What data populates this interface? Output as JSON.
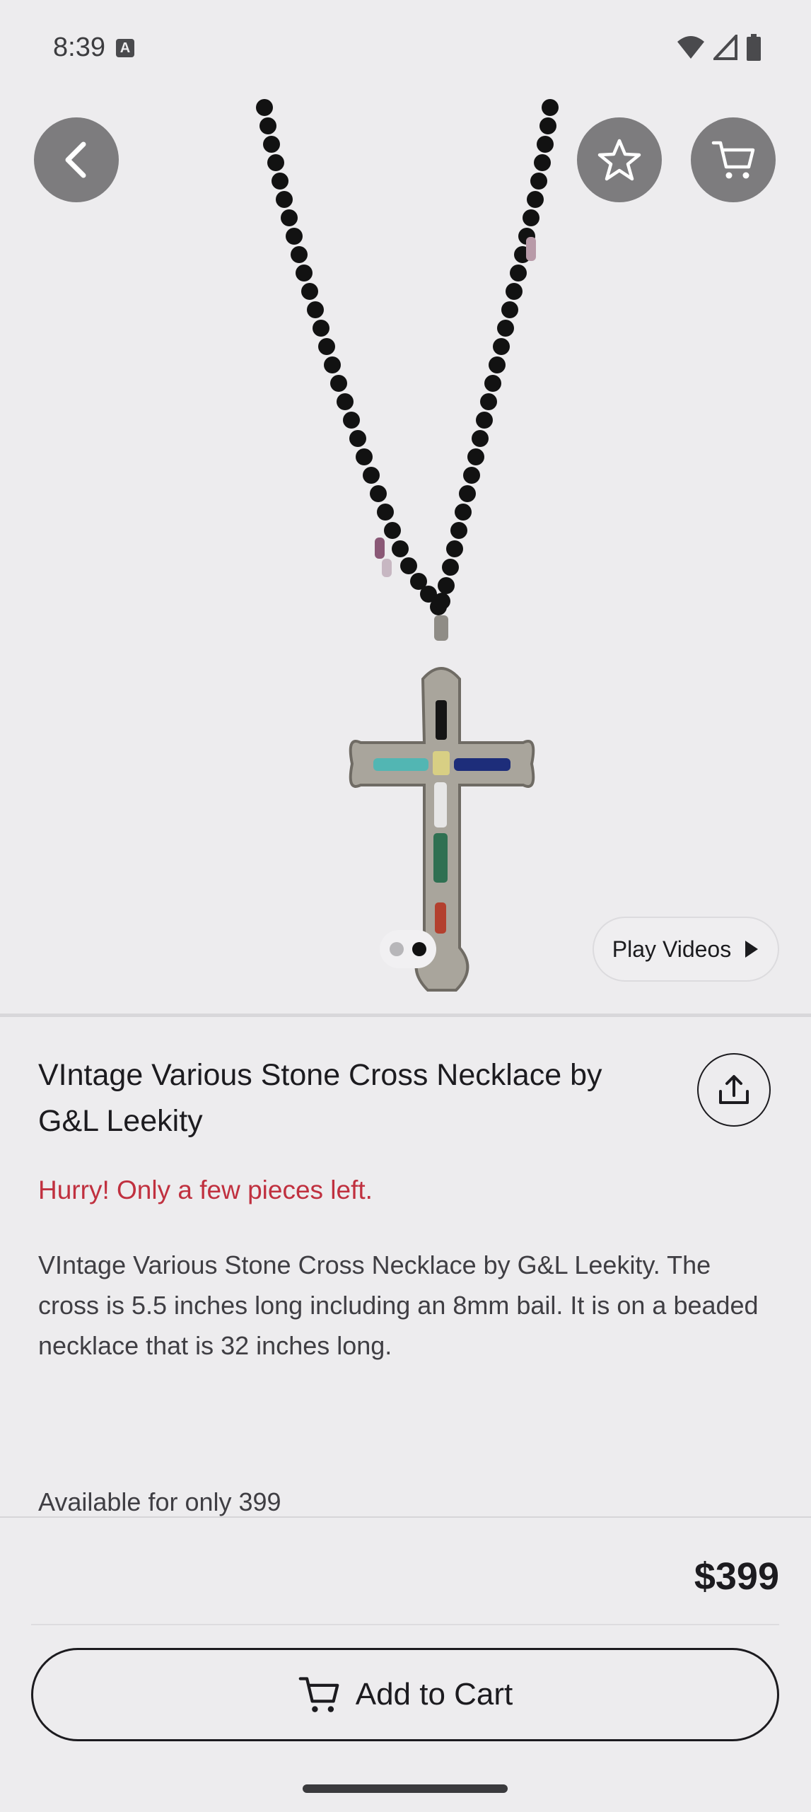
{
  "status_bar": {
    "time": "8:39",
    "icons": [
      "notification-a-icon",
      "wifi-icon",
      "signal-icon",
      "battery-icon"
    ]
  },
  "hero": {
    "image_alt": "Vintage stone cross necklace on beaded chain",
    "carousel": {
      "total": 2,
      "active_index": 1
    },
    "play_videos_label": "Play Videos"
  },
  "product": {
    "title": "VIntage Various Stone Cross Necklace by G&L Leekity",
    "stock_warning": "Hurry! Only a few pieces left.",
    "description": "VIntage Various Stone Cross Necklace by G&L Leekity. The cross is 5.5 inches long including an 8mm bail. It is on a beaded necklace that is 32 inches long.",
    "availability": "Available for only 399",
    "price": "$399"
  },
  "actions": {
    "add_to_cart_label": "Add to Cart"
  },
  "colors": {
    "background": "#edecee",
    "overlay_button": "#7d7c7e",
    "warning_text": "#c0303f"
  }
}
